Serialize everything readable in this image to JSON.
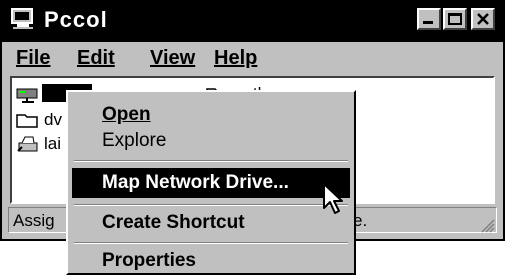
{
  "window": {
    "title": "Pccol",
    "icon": "computer-icon",
    "buttons": [
      "minimize-icon",
      "maximize-icon",
      "close-icon"
    ]
  },
  "menubar": {
    "items": [
      {
        "label": "File"
      },
      {
        "label": "Edit"
      },
      {
        "label": "View"
      },
      {
        "label": "Help"
      }
    ]
  },
  "files": [
    {
      "label": "",
      "icon": "network-drive-icon",
      "selected": true
    },
    {
      "label": "dv",
      "icon": "folder-icon"
    },
    {
      "label": "lai",
      "icon": "printer-icon"
    },
    {
      "label": "netlogon",
      "icon": "folder-icon"
    }
  ],
  "statusbar": {
    "left": "Assig",
    "right": "e."
  },
  "context_menu": {
    "items": [
      {
        "label": "Open",
        "bold": true
      },
      {
        "label": "Explore"
      },
      {
        "label": "Map Network Drive...",
        "highlighted": true
      },
      {
        "label": "Create Shortcut"
      },
      {
        "label": "Properties"
      }
    ]
  },
  "colors": {
    "titlebar": "#000000",
    "face": "#c0c0c0",
    "highlight": "#000000",
    "highlight_text": "#ffffff"
  }
}
